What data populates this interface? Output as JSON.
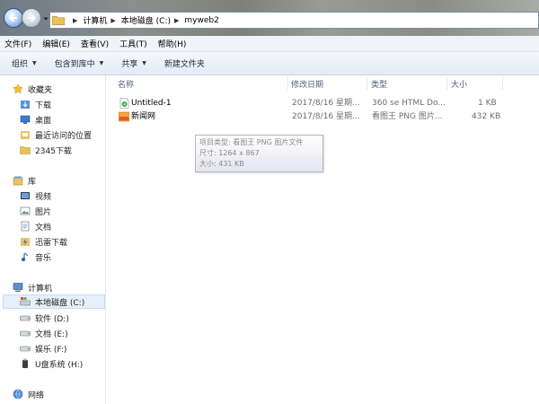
{
  "address": {
    "crumbs": [
      "计算机",
      "本地磁盘 (C:)",
      "myweb2"
    ]
  },
  "menu": [
    "文件(F)",
    "编辑(E)",
    "查看(V)",
    "工具(T)",
    "帮助(H)"
  ],
  "toolbar": {
    "organize": "组织",
    "include_library": "包含到库中",
    "share": "共享",
    "new_folder": "新建文件夹"
  },
  "nav": {
    "favorites": "收藏夹",
    "downloads": "下载",
    "desktop": "桌面",
    "recent": "最近访问的位置",
    "dl2345": "2345下载",
    "libraries": "库",
    "videos": "视频",
    "pictures": "图片",
    "documents": "文档",
    "thunder": "迅雷下载",
    "music": "音乐",
    "computer": "计算机",
    "drive_c": "本地磁盘 (C:)",
    "drive_d": "软件 (D:)",
    "drive_e": "文档 (E:)",
    "drive_f": "娱乐 (F:)",
    "drive_h": "U盘系统 (H:)",
    "network": "网络"
  },
  "columns": {
    "name": "名称",
    "date": "修改日期",
    "type": "类型",
    "size": "大小"
  },
  "files": [
    {
      "name": "Untitled-1",
      "date": "2017/8/16 星期...",
      "type": "360 se HTML Do...",
      "size": "1 KB",
      "icon": "html-file-icon"
    },
    {
      "name": "新闻网",
      "date": "2017/8/16 星期...",
      "type": "看图王 PNG 图片...",
      "size": "432 KB",
      "icon": "png-file-icon"
    }
  ],
  "tooltip": {
    "line1": "项目类型: 看图王 PNG 图片文件",
    "line2": "尺寸: 1264 x 867",
    "line3": "大小: 431 KB"
  },
  "colors": {
    "selected_bg": "#e5f0fb",
    "toolbar_text": "#1c2b3e",
    "header_text": "#4c607a"
  }
}
